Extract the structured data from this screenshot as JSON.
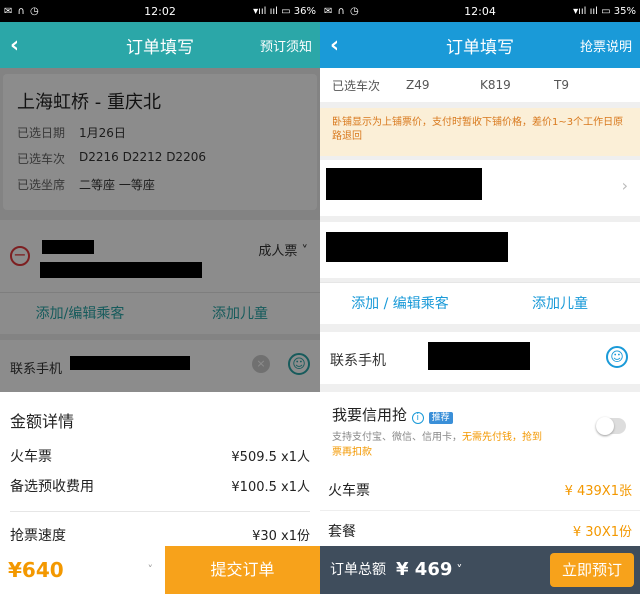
{
  "left": {
    "status": {
      "time": "12:02",
      "battery": "36%"
    },
    "nav": {
      "title": "订单填写",
      "action": "预订须知",
      "back": "‹"
    },
    "trip": {
      "route": "上海虹桥 - 重庆北",
      "date_label": "已选日期",
      "date": "1月26日",
      "trains_label": "已选车次",
      "trains": "D2216 D2212 D2206",
      "seat_label": "已选坐席",
      "seats": "二等座 一等座"
    },
    "passenger": {
      "type": "成人票 ˅",
      "minus": "−"
    },
    "add": {
      "edit": "添加/编辑乘客",
      "child": "添加儿童"
    },
    "contact": {
      "label": "联系手机"
    },
    "details": {
      "heading": "金额详情",
      "items": [
        {
          "name": "火车票",
          "value": "¥509.5 x1人"
        },
        {
          "name": "备选预收费用",
          "value": "¥100.5 x1人"
        },
        {
          "name": "抢票速度",
          "value": "¥30 x1份"
        }
      ]
    },
    "bottom": {
      "total": "¥640",
      "chevron": "˅",
      "submit": "提交订单"
    }
  },
  "right": {
    "status": {
      "time": "12:04",
      "battery": "35%"
    },
    "nav": {
      "title": "订单填写",
      "action": "抢票说明",
      "back": "‹"
    },
    "trains_row": {
      "label": "已选车次",
      "trains": [
        "Z49",
        "K819",
        "T9"
      ]
    },
    "notice": "卧铺显示为上铺票价，支付时暂收下铺价格，差价1~3个工作日原路退回",
    "add": {
      "edit": "添加 / 编辑乘客",
      "child": "添加儿童"
    },
    "contact": {
      "label": "联系手机"
    },
    "credit": {
      "title": "我要信用抢",
      "info": "i",
      "badge": "推荐",
      "desc1": "支持支付宝、微信、信用卡，",
      "desc_hl": "无需先付钱，抢到票再扣款"
    },
    "items": [
      {
        "name": "火车票",
        "value": "¥ 439X1张"
      },
      {
        "name": "套餐",
        "value": "¥ 30X1份"
      }
    ],
    "bottom": {
      "label": "订单总额",
      "total": "¥ 469",
      "chevron": "˅",
      "submit": "立即预订"
    }
  },
  "colors": {
    "teal": "#2ba7a8",
    "blue": "#1a9ad8",
    "orange": "#f7a21b",
    "red": "#e4393c",
    "dark": "#3f4d5c"
  }
}
